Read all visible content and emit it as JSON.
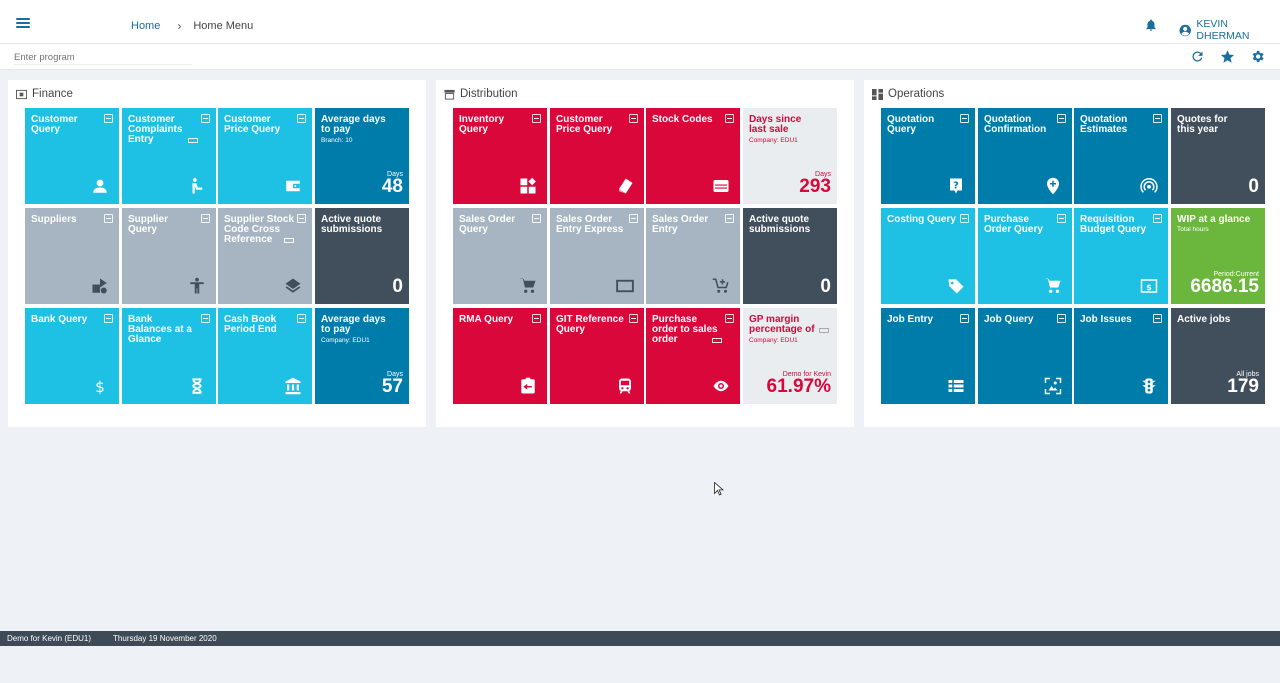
{
  "breadcrumb": {
    "home": "Home",
    "current": "Home Menu"
  },
  "user": {
    "name": "KEVIN DHERMAN"
  },
  "program": {
    "placeholder": "Enter program"
  },
  "finance": {
    "title": "Finance",
    "tiles": [
      {
        "label": "Customer Query",
        "icon": "user-icon"
      },
      {
        "label": "Customer Complaints Entry",
        "icon": "complaint-icon"
      },
      {
        "label": "Customer Price Query",
        "icon": "wallet-icon"
      },
      {
        "label": "Average days to pay",
        "sub": "Branch: 10",
        "unit": "Days",
        "value": "48"
      },
      {
        "label": "Suppliers",
        "icon": "supplier-icon"
      },
      {
        "label": "Supplier Query",
        "icon": "person-icon"
      },
      {
        "label": "Supplier Stock Code Cross Reference",
        "icon": "layers-icon"
      },
      {
        "label": "Active quote submissions",
        "value": "0"
      },
      {
        "label": "Bank Query",
        "icon": "dollar-icon"
      },
      {
        "label": "Bank Balances at a Glance",
        "icon": "hourglass-icon"
      },
      {
        "label": "Cash Book Period End",
        "icon": "bank-icon"
      },
      {
        "label": "Average days to pay",
        "sub": "Company: EDU1",
        "unit": "Days",
        "value": "57"
      }
    ]
  },
  "distribution": {
    "title": "Distribution",
    "tiles": [
      {
        "label": "Inventory Query",
        "icon": "widgets-icon"
      },
      {
        "label": "Customer Price Query",
        "icon": "tag-icon"
      },
      {
        "label": "Stock Codes",
        "icon": "card-icon"
      },
      {
        "label": "Days since last sale",
        "sub": "Company: EDU1",
        "unit": "Days",
        "value": "293"
      },
      {
        "label": "Sales Order Query",
        "icon": "cart-icon"
      },
      {
        "label": "Sales Order Entry Express",
        "icon": "screen-icon"
      },
      {
        "label": "Sales Order Entry",
        "icon": "cart-add-icon"
      },
      {
        "label": "Active quote submissions",
        "value": "0"
      },
      {
        "label": "RMA Query",
        "icon": "return-icon"
      },
      {
        "label": "GIT Reference Query",
        "icon": "train-icon"
      },
      {
        "label": "Purchase order to sales order",
        "icon": "eye-icon"
      },
      {
        "label": "GP margin percentage of",
        "sub": "Company: EDU1",
        "unit": "Demo for Kevin",
        "value": "61.97%"
      }
    ]
  },
  "operations": {
    "title": "Operations",
    "tiles": [
      {
        "label": "Quotation Query",
        "icon": "question-icon"
      },
      {
        "label": "Quotation Confirmation",
        "icon": "location-add-icon"
      },
      {
        "label": "Quotation Estimates",
        "icon": "signal-icon"
      },
      {
        "label": "Quotes for this year",
        "value": "0"
      },
      {
        "label": "Costing Query",
        "icon": "label-icon"
      },
      {
        "label": "Purchase Order Query",
        "icon": "cart-icon"
      },
      {
        "label": "Requisition Budget Query",
        "icon": "money-icon"
      },
      {
        "label": "WIP at a glance",
        "sub": "Total hours",
        "unit": "Period:Current",
        "value": "6686.15"
      },
      {
        "label": "Job Entry",
        "icon": "list-icon"
      },
      {
        "label": "Job Query",
        "icon": "scan-icon"
      },
      {
        "label": "Job Issues",
        "icon": "traffic-icon"
      },
      {
        "label": "Active jobs",
        "unit": "All jobs",
        "value": "179"
      }
    ]
  },
  "status": {
    "company": "Demo for Kevin (EDU1)",
    "date": "Thursday 19  November 2020"
  }
}
